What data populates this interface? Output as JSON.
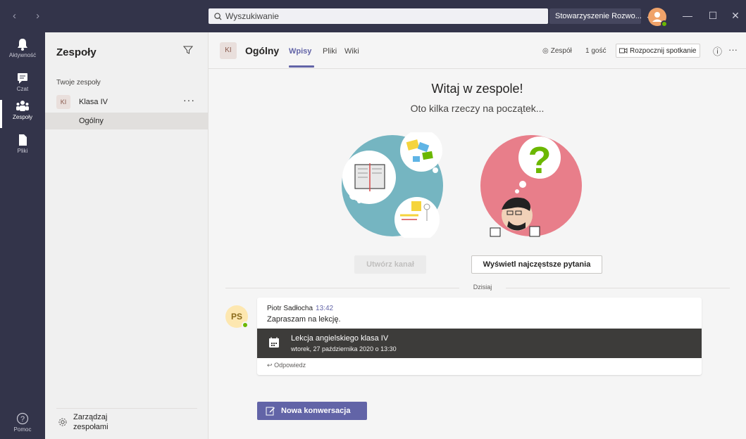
{
  "titlebar": {
    "search_placeholder": "Wyszukiwanie",
    "org_name": "Stowarzyszenie Rozwo...",
    "minimize": "—",
    "maximize": "☐",
    "close": "✕"
  },
  "rail": {
    "items": [
      {
        "label": "Aktywność",
        "icon": "bell-icon"
      },
      {
        "label": "Czat",
        "icon": "chat-icon"
      },
      {
        "label": "Zespoły",
        "icon": "teams-icon",
        "active": true
      },
      {
        "label": "Pliki",
        "icon": "files-icon"
      }
    ],
    "help_label": "Pomoc"
  },
  "panel": {
    "title": "Zespoły",
    "section_label": "Twoje zespoły",
    "team": {
      "initials": "KI",
      "name": "Klasa IV"
    },
    "channel": "Ogólny",
    "manage_label": "Zarządzaj zespołami"
  },
  "header": {
    "initials": "KI",
    "title": "Ogólny",
    "tabs": [
      "Wpisy",
      "Pliki",
      "Wiki"
    ],
    "team_chip": "Zespół",
    "guests": "1 gość",
    "meet_button": "Rozpocznij spotkanie"
  },
  "welcome": {
    "title": "Witaj w zespole!",
    "subtitle": "Oto kilka rzeczy na początek...",
    "create_channel": "Utwórz kanał",
    "faq": "Wyświetl najczęstsze pytania"
  },
  "feed": {
    "day_label": "Dzisiaj",
    "message": {
      "initials": "PS",
      "author": "Piotr Sadłocha",
      "time": "13:42",
      "text": "Zapraszam na lekcję.",
      "meeting_title": "Lekcja angielskiego klasa IV",
      "meeting_date": "wtorek, 27 października 2020 o 13:30",
      "reply": "Odpowiedz"
    },
    "new_conversation": "Nowa konwersacja"
  },
  "colors": {
    "brand": "#6264a7",
    "rail": "#33344a",
    "presence": "#6bb700"
  }
}
